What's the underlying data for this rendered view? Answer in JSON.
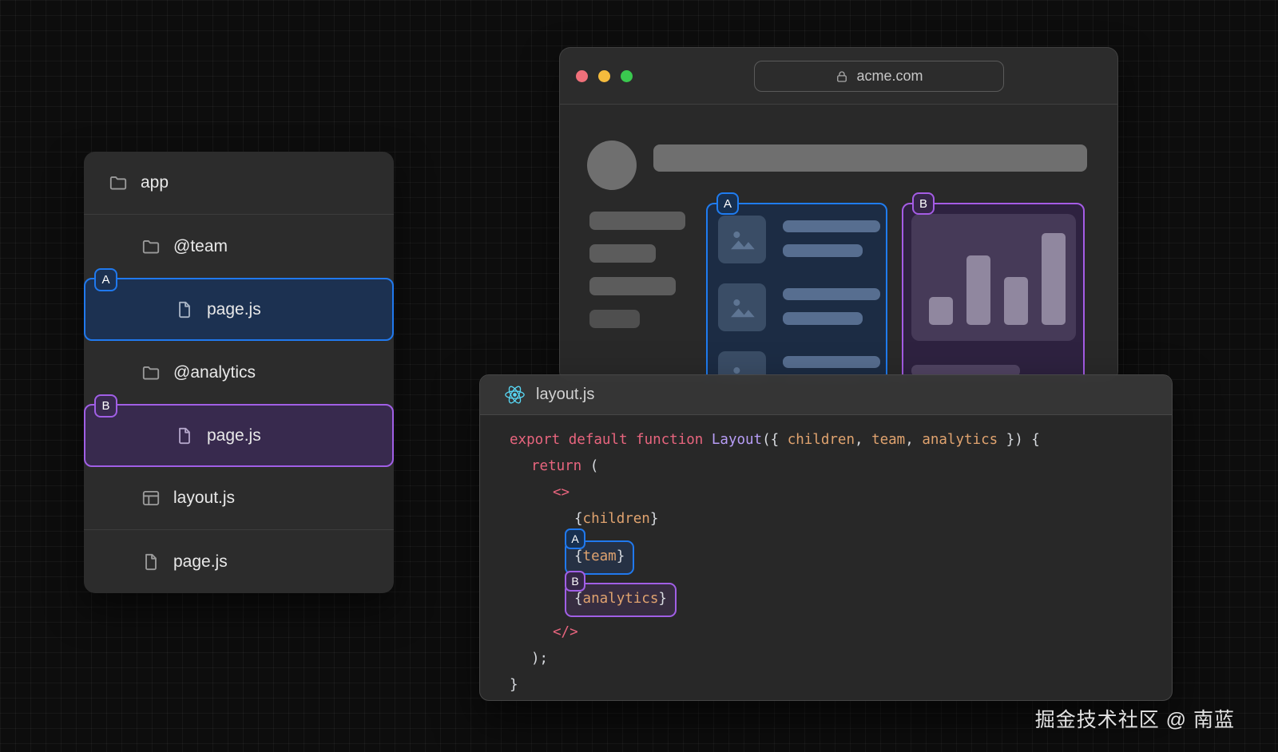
{
  "watermark": "掘金技术社区 @ 南蓝",
  "file_tree": {
    "items": [
      {
        "label": "app",
        "icon": "folder"
      },
      {
        "label": "@team",
        "icon": "folder"
      },
      {
        "label": "page.js",
        "icon": "file",
        "badge": "A"
      },
      {
        "label": "@analytics",
        "icon": "folder"
      },
      {
        "label": "page.js",
        "icon": "file",
        "badge": "B"
      },
      {
        "label": "layout.js",
        "icon": "layout"
      },
      {
        "label": "page.js",
        "icon": "file"
      }
    ]
  },
  "browser": {
    "url": "acme.com",
    "panels": [
      {
        "badge": "A"
      },
      {
        "badge": "B"
      }
    ]
  },
  "editor": {
    "title": "layout.js",
    "lines": [
      {
        "indent": 0,
        "tokens": [
          [
            "kw",
            "export default function "
          ],
          [
            "fn",
            "Layout"
          ],
          [
            "pl",
            "({ "
          ],
          [
            "pr",
            "children"
          ],
          [
            "pl",
            ", "
          ],
          [
            "pr",
            "team"
          ],
          [
            "pl",
            ", "
          ],
          [
            "pr",
            "analytics"
          ],
          [
            "pl",
            " }) {"
          ]
        ]
      },
      {
        "indent": 1,
        "tokens": [
          [
            "kw",
            "return "
          ],
          [
            "pl",
            "("
          ]
        ]
      },
      {
        "indent": 2,
        "tokens": [
          [
            "kw",
            "<>"
          ]
        ]
      },
      {
        "indent": 3,
        "tokens": [
          [
            "pl",
            "{"
          ],
          [
            "pr",
            "children"
          ],
          [
            "pl",
            "}"
          ]
        ]
      },
      {
        "indent": 3,
        "box": "A",
        "tokens": [
          [
            "pl",
            "{"
          ],
          [
            "pr",
            "team"
          ],
          [
            "pl",
            "}"
          ]
        ]
      },
      {
        "indent": 3,
        "box": "B",
        "tokens": [
          [
            "pl",
            "{"
          ],
          [
            "pr",
            "analytics"
          ],
          [
            "pl",
            "}"
          ]
        ]
      },
      {
        "indent": 2,
        "tokens": [
          [
            "kw",
            "</>"
          ]
        ]
      },
      {
        "indent": 1,
        "tokens": [
          [
            "pl",
            ");"
          ]
        ]
      },
      {
        "indent": 0,
        "tokens": [
          [
            "pl",
            "}"
          ]
        ]
      }
    ]
  },
  "colors": {
    "background": "#0d0d0d",
    "panel_gray": "#2c2c2c",
    "blue_accent": "#2079ee",
    "purple_accent": "#a15fe6",
    "react_cyan": "#58d6f3",
    "traffic_red": "#f0707a",
    "traffic_yellow": "#f5bb3d",
    "traffic_green": "#3ac94f",
    "code_keyword": "#e8657e",
    "code_function": "#b79df6",
    "code_param": "#e0a36f",
    "code_plain": "#d8dbe0"
  }
}
